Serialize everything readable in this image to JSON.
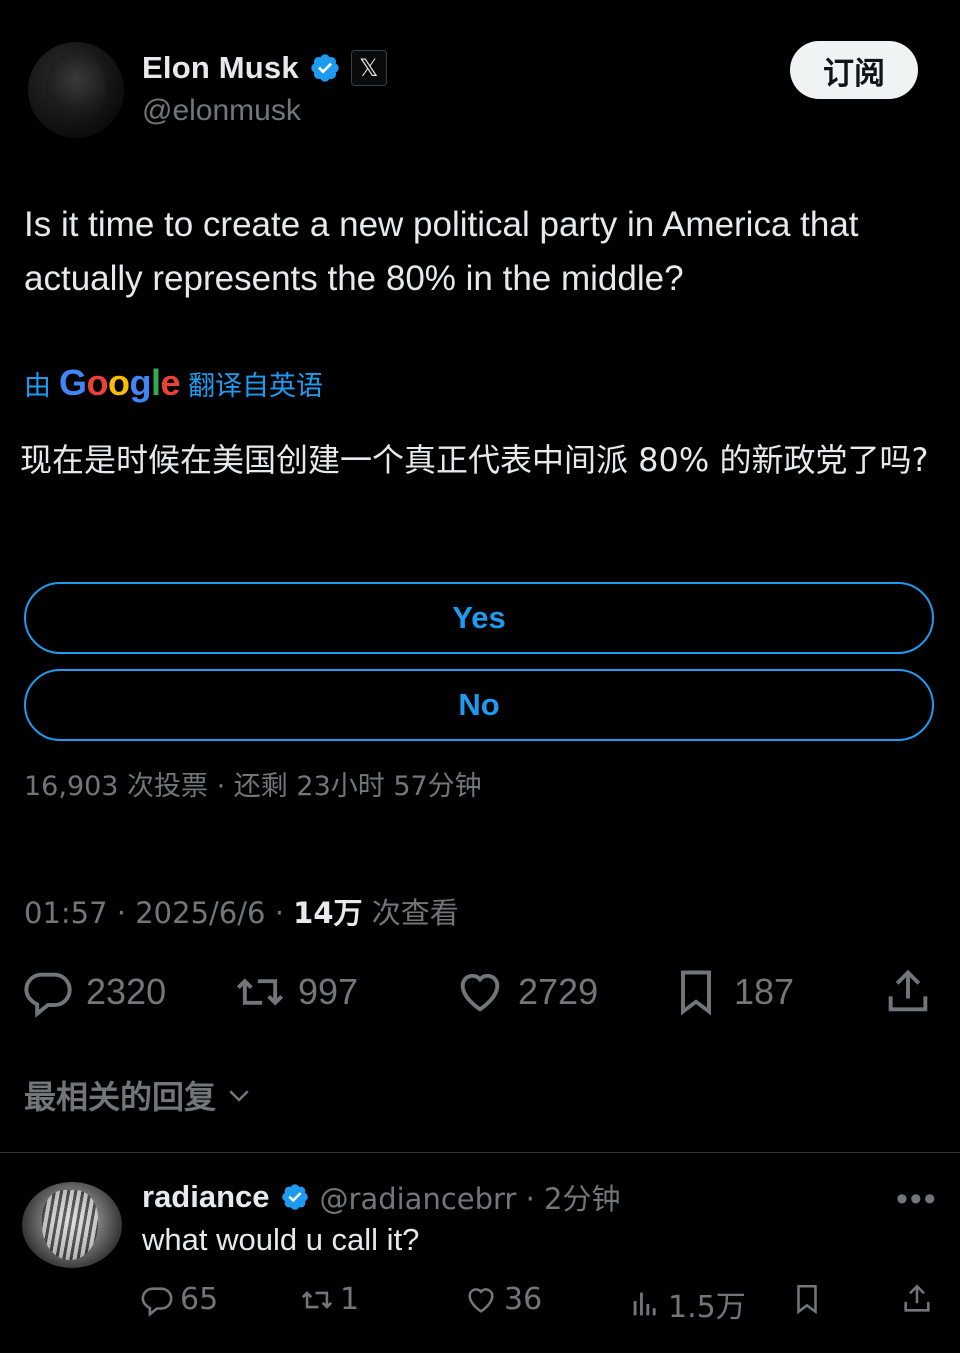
{
  "author": {
    "name": "Elon Musk",
    "handle": "@elonmusk",
    "badge_x": "𝕏"
  },
  "subscribe_label": "订阅",
  "tweet": {
    "text": "Is it time to create a new political party in America that actually represents the 80% in the middle?",
    "translate_prefix": "由",
    "translate_suffix": "翻译自英语",
    "translated_text": "现在是时候在美国创建一个真正代表中间派 80% 的新政党了吗?"
  },
  "poll": {
    "options": [
      {
        "label": "Yes"
      },
      {
        "label": "No"
      }
    ],
    "meta": "16,903 次投票 · 还剩 23小时 57分钟"
  },
  "timestamp": {
    "time": "01:57 · 2025/6/6 · ",
    "views_count": "14万",
    "views_label": " 次查看"
  },
  "actions": {
    "replies": "2320",
    "retweets": "997",
    "likes": "2729",
    "bookmarks": "187"
  },
  "sort_label": "最相关的回复",
  "reply": {
    "name": "radiance",
    "handle": "@radiancebrr · 2分钟",
    "text": "what would u call it?",
    "replies": "65",
    "retweets": "1",
    "likes": "36",
    "views": "1.5万"
  },
  "colors": {
    "background": "#000000",
    "accent": "#1d9bf0",
    "text": "#e7e9ea",
    "muted": "#71767b"
  }
}
